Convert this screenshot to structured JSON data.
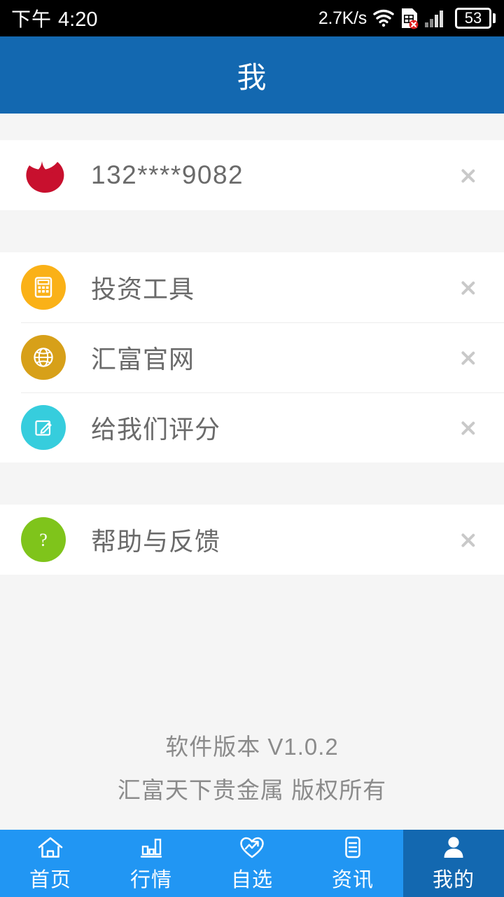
{
  "status_bar": {
    "ampm": "下午",
    "time": "4:20",
    "net_speed": "2.7K/s",
    "wifi_icon": "wifi-icon",
    "sim_icon": "sim-card-error-icon",
    "signal_icon": "signal-bars-icon",
    "battery_level": "53"
  },
  "header": {
    "title": "我"
  },
  "account": {
    "logo_icon": "brand-crescent-logo-icon",
    "phone": "132****9082",
    "chevron_icon": "chevron-right-icon"
  },
  "menu_groups": [
    {
      "items": [
        {
          "icon": "calculator-icon",
          "icon_color": "#fab117",
          "label": "投资工具",
          "chevron_icon": "chevron-right-icon"
        },
        {
          "icon": "globe-icon",
          "icon_color": "#d7a019",
          "label": "汇富官网",
          "chevron_icon": "chevron-right-icon"
        },
        {
          "icon": "edit-rate-icon",
          "icon_color": "#36cddd",
          "label": "给我们评分",
          "chevron_icon": "chevron-right-icon"
        }
      ]
    },
    {
      "items": [
        {
          "icon": "question-mark-icon",
          "icon_color": "#7fc41b",
          "label": "帮助与反馈",
          "chevron_icon": "chevron-right-icon"
        }
      ]
    }
  ],
  "footer": {
    "version_line": "软件版本  V1.0.2",
    "copyright_line": "汇富天下贵金属 版权所有"
  },
  "tabbar": {
    "active_index": 4,
    "active_bg": "#1368b0",
    "bg": "#2196f3",
    "items": [
      {
        "icon": "home-icon",
        "label": "首页"
      },
      {
        "icon": "bar-chart-icon",
        "label": "行情"
      },
      {
        "icon": "heart-trend-icon",
        "label": "自选"
      },
      {
        "icon": "news-document-icon",
        "label": "资讯"
      },
      {
        "icon": "person-icon",
        "label": "我的"
      }
    ]
  },
  "theme": {
    "header_blue": "#1368b0",
    "tab_blue": "#2196f3",
    "page_bg": "#f5f5f5",
    "row_bg": "#ffffff",
    "text_gray": "#6a6a6a",
    "footer_gray": "#8b8b8b",
    "chevron_gray": "#c9c9c9",
    "brand_red": "#c8102e"
  }
}
